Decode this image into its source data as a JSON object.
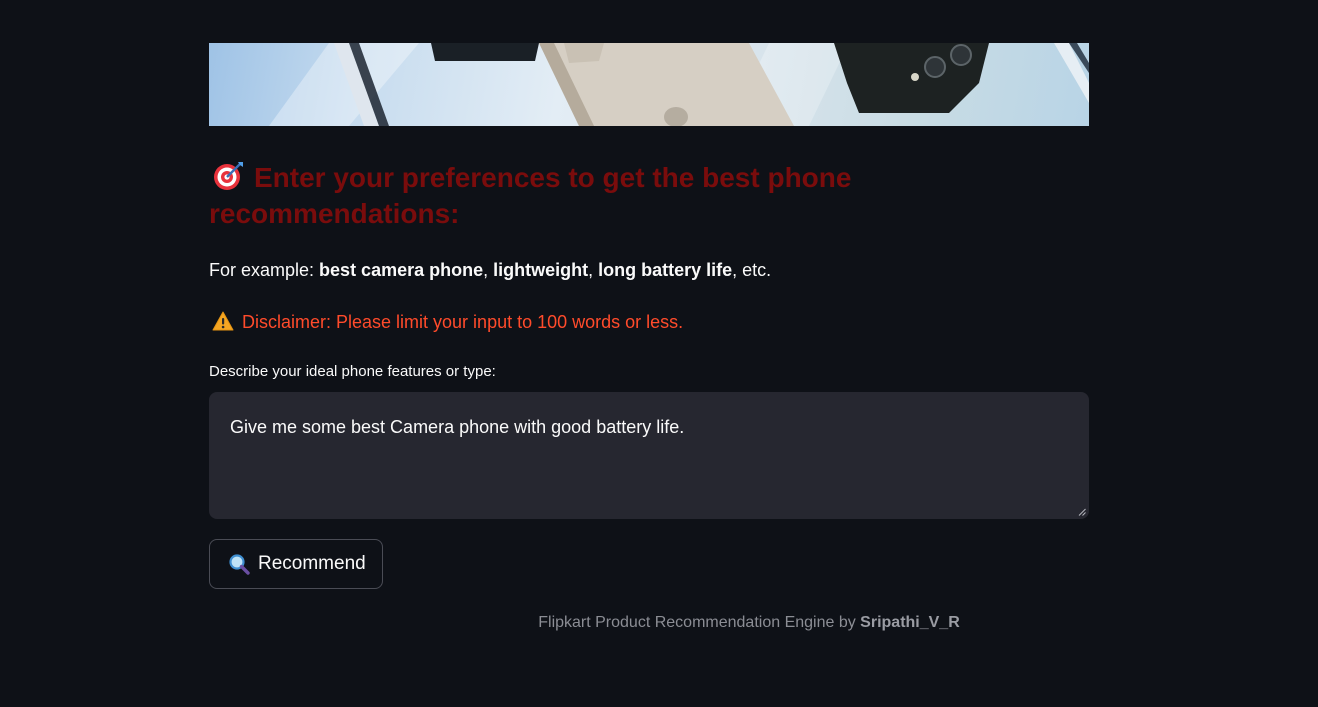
{
  "header": {
    "icon": "direct-hit-emoji",
    "title": "Enter your preferences to get the best phone recommendations:"
  },
  "example": {
    "prefix": "For example: ",
    "items": [
      "best camera phone",
      "lightweight",
      "long battery life"
    ],
    "sep1": ", ",
    "sep2": ", ",
    "suffix": ", etc."
  },
  "disclaimer": {
    "icon": "warning-icon",
    "text": "Disclaimer: Please limit your input to 100 words or less."
  },
  "input": {
    "label": "Describe your ideal phone features or type:",
    "value": "Give me some best Camera phone with good battery life."
  },
  "button": {
    "icon": "magnifier-icon",
    "label": "Recommend"
  },
  "footer": {
    "text": "Flipkart Product Recommendation Engine by ",
    "author": "Sripathi_V_R"
  },
  "colors": {
    "background": "#0e1117",
    "heading": "#7a0c0c",
    "disclaimer": "#ff4b2b",
    "input_bg": "#262730"
  }
}
